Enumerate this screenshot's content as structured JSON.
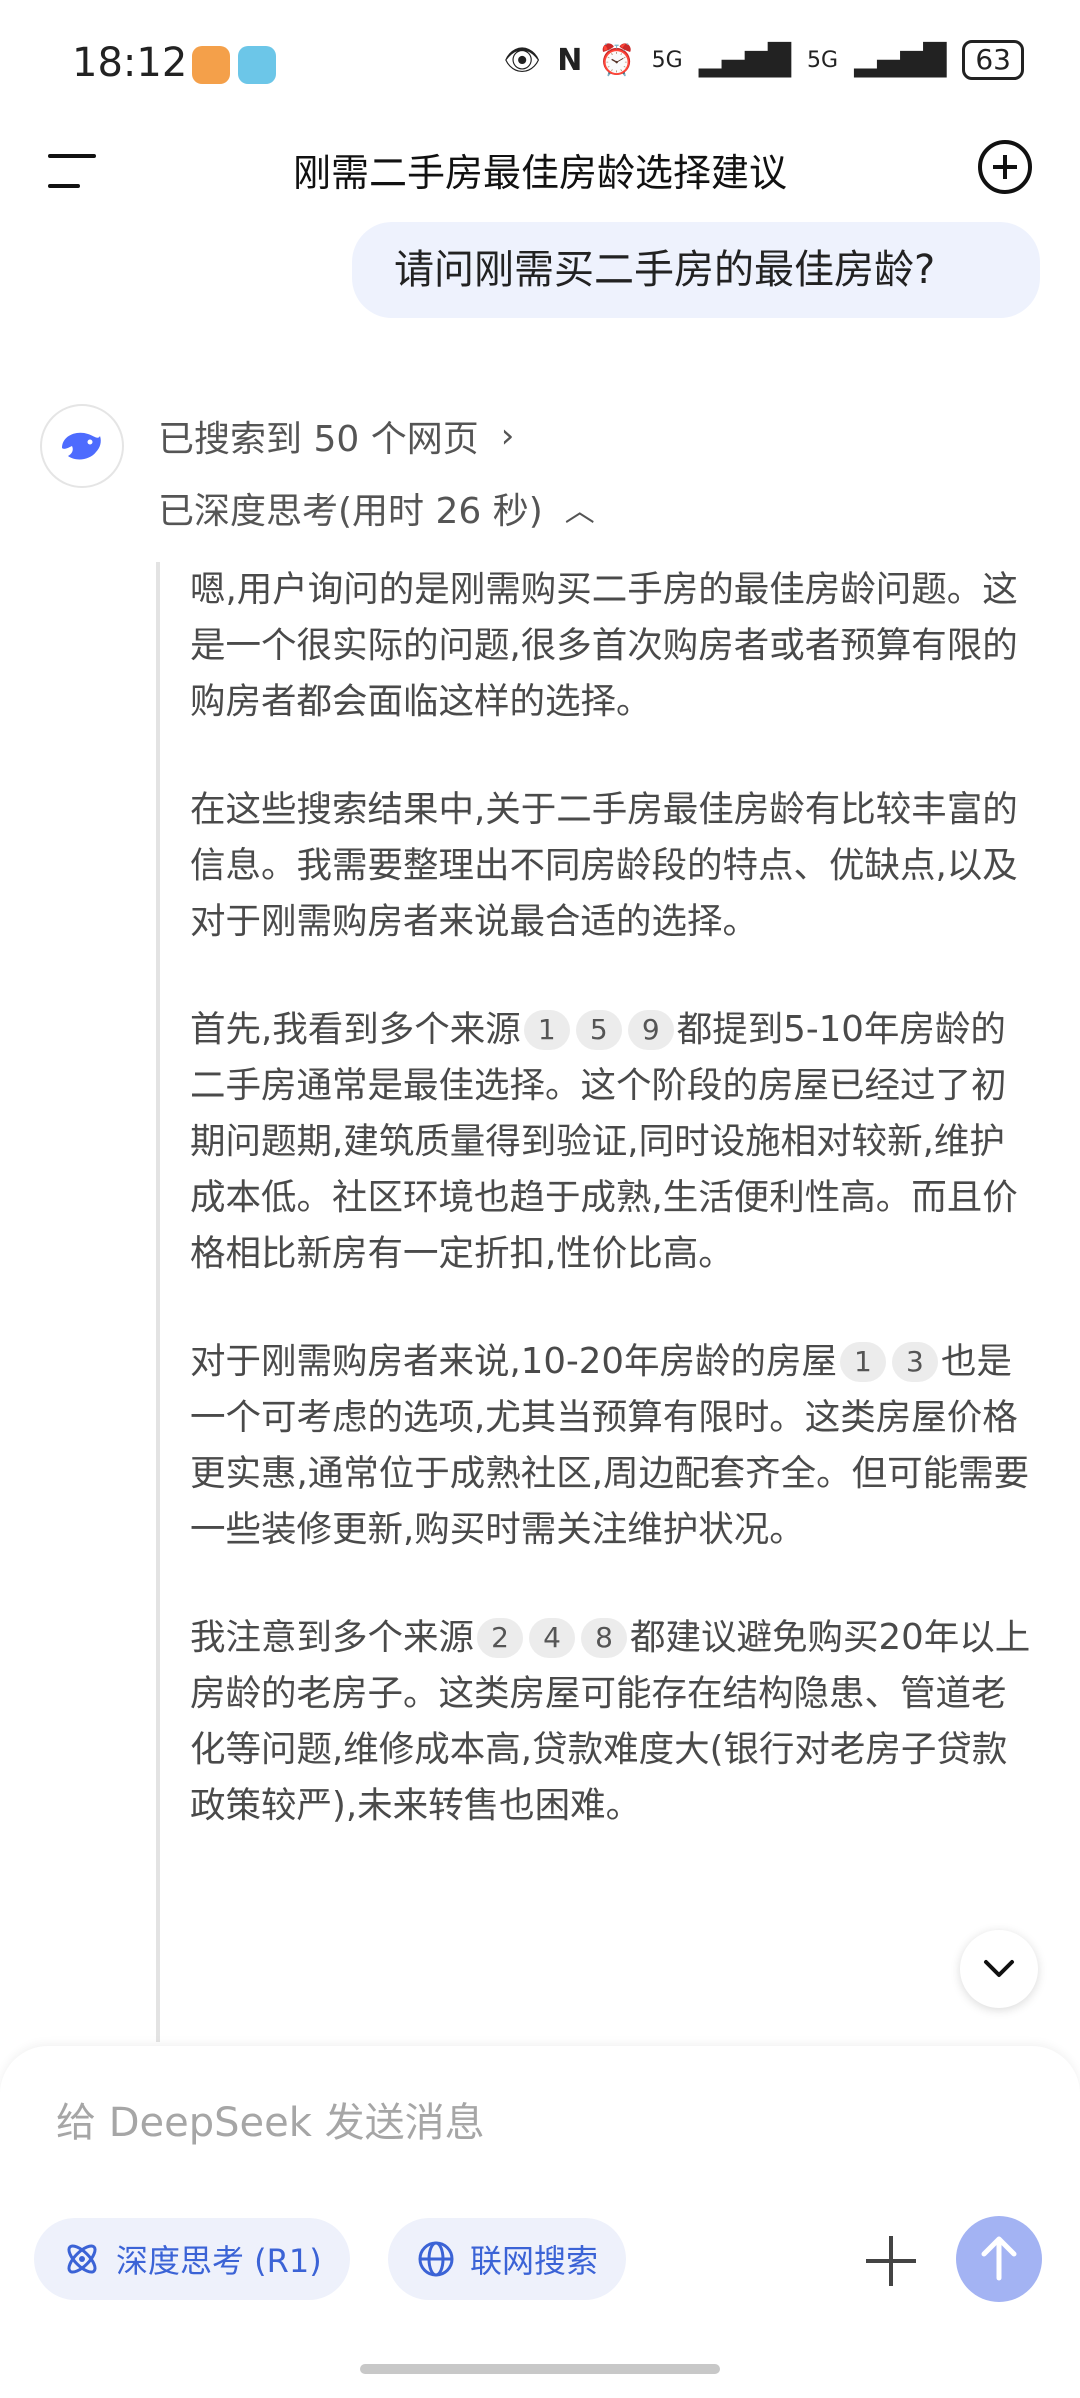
{
  "status": {
    "time": "18:12",
    "battery": "63",
    "net1": "5G",
    "net2": "5G"
  },
  "header": {
    "title": "刚需二手房最佳房龄选择建议"
  },
  "user_message": "请问刚需买二手房的最佳房龄?",
  "search": {
    "label": "已搜索到 50 个网页"
  },
  "thinking_header": {
    "label": "已深度思考(用时 26 秒)"
  },
  "thinking": {
    "p1": "嗯,用户询问的是刚需购买二手房的最佳房龄问题。这是一个很实际的问题,很多首次购房者或者预算有限的购房者都会面临这样的选择。",
    "p2": "在这些搜索结果中,关于二手房最佳房龄有比较丰富的信息。我需要整理出不同房龄段的特点、优缺点,以及对于刚需购房者来说最合适的选择。",
    "p3_a": "首先,我看到多个来源",
    "p3_b": "都提到5-10年房龄的二手房通常是最佳选择。这个阶段的房屋已经过了初期问题期,建筑质量得到验证,同时设施相对较新,维护成本低。社区环境也趋于成熟,生活便利性高。而且价格相比新房有一定折扣,性价比高。",
    "p4_a": "对于刚需购房者来说,10-20年房龄的房屋",
    "p4_b": "也是一个可考虑的选项,尤其当预算有限时。这类房屋价格更实惠,通常位于成熟社区,周边配套齐全。但可能需要一些装修更新,购买时需关注维护状况。",
    "p5_a": "我注意到多个来源",
    "p5_b": "都建议避免购买20年以上房龄的老房子。这类房屋可能存在结构隐患、管道老化等问题,维修成本高,贷款难度大(银行对老房子贷款政策较严),未来转售也困难。",
    "cites_p3": [
      "1",
      "5",
      "9"
    ],
    "cites_p4": [
      "1",
      "3"
    ],
    "cites_p5": [
      "2",
      "4",
      "8"
    ]
  },
  "composer": {
    "placeholder": "给 DeepSeek 发送消息",
    "deep_think_label": "深度思考 (R1)",
    "web_search_label": "联网搜索"
  },
  "colors": {
    "accent": "#3b63d6",
    "send": "#a3b3f3",
    "bubble": "#eef2fd"
  }
}
